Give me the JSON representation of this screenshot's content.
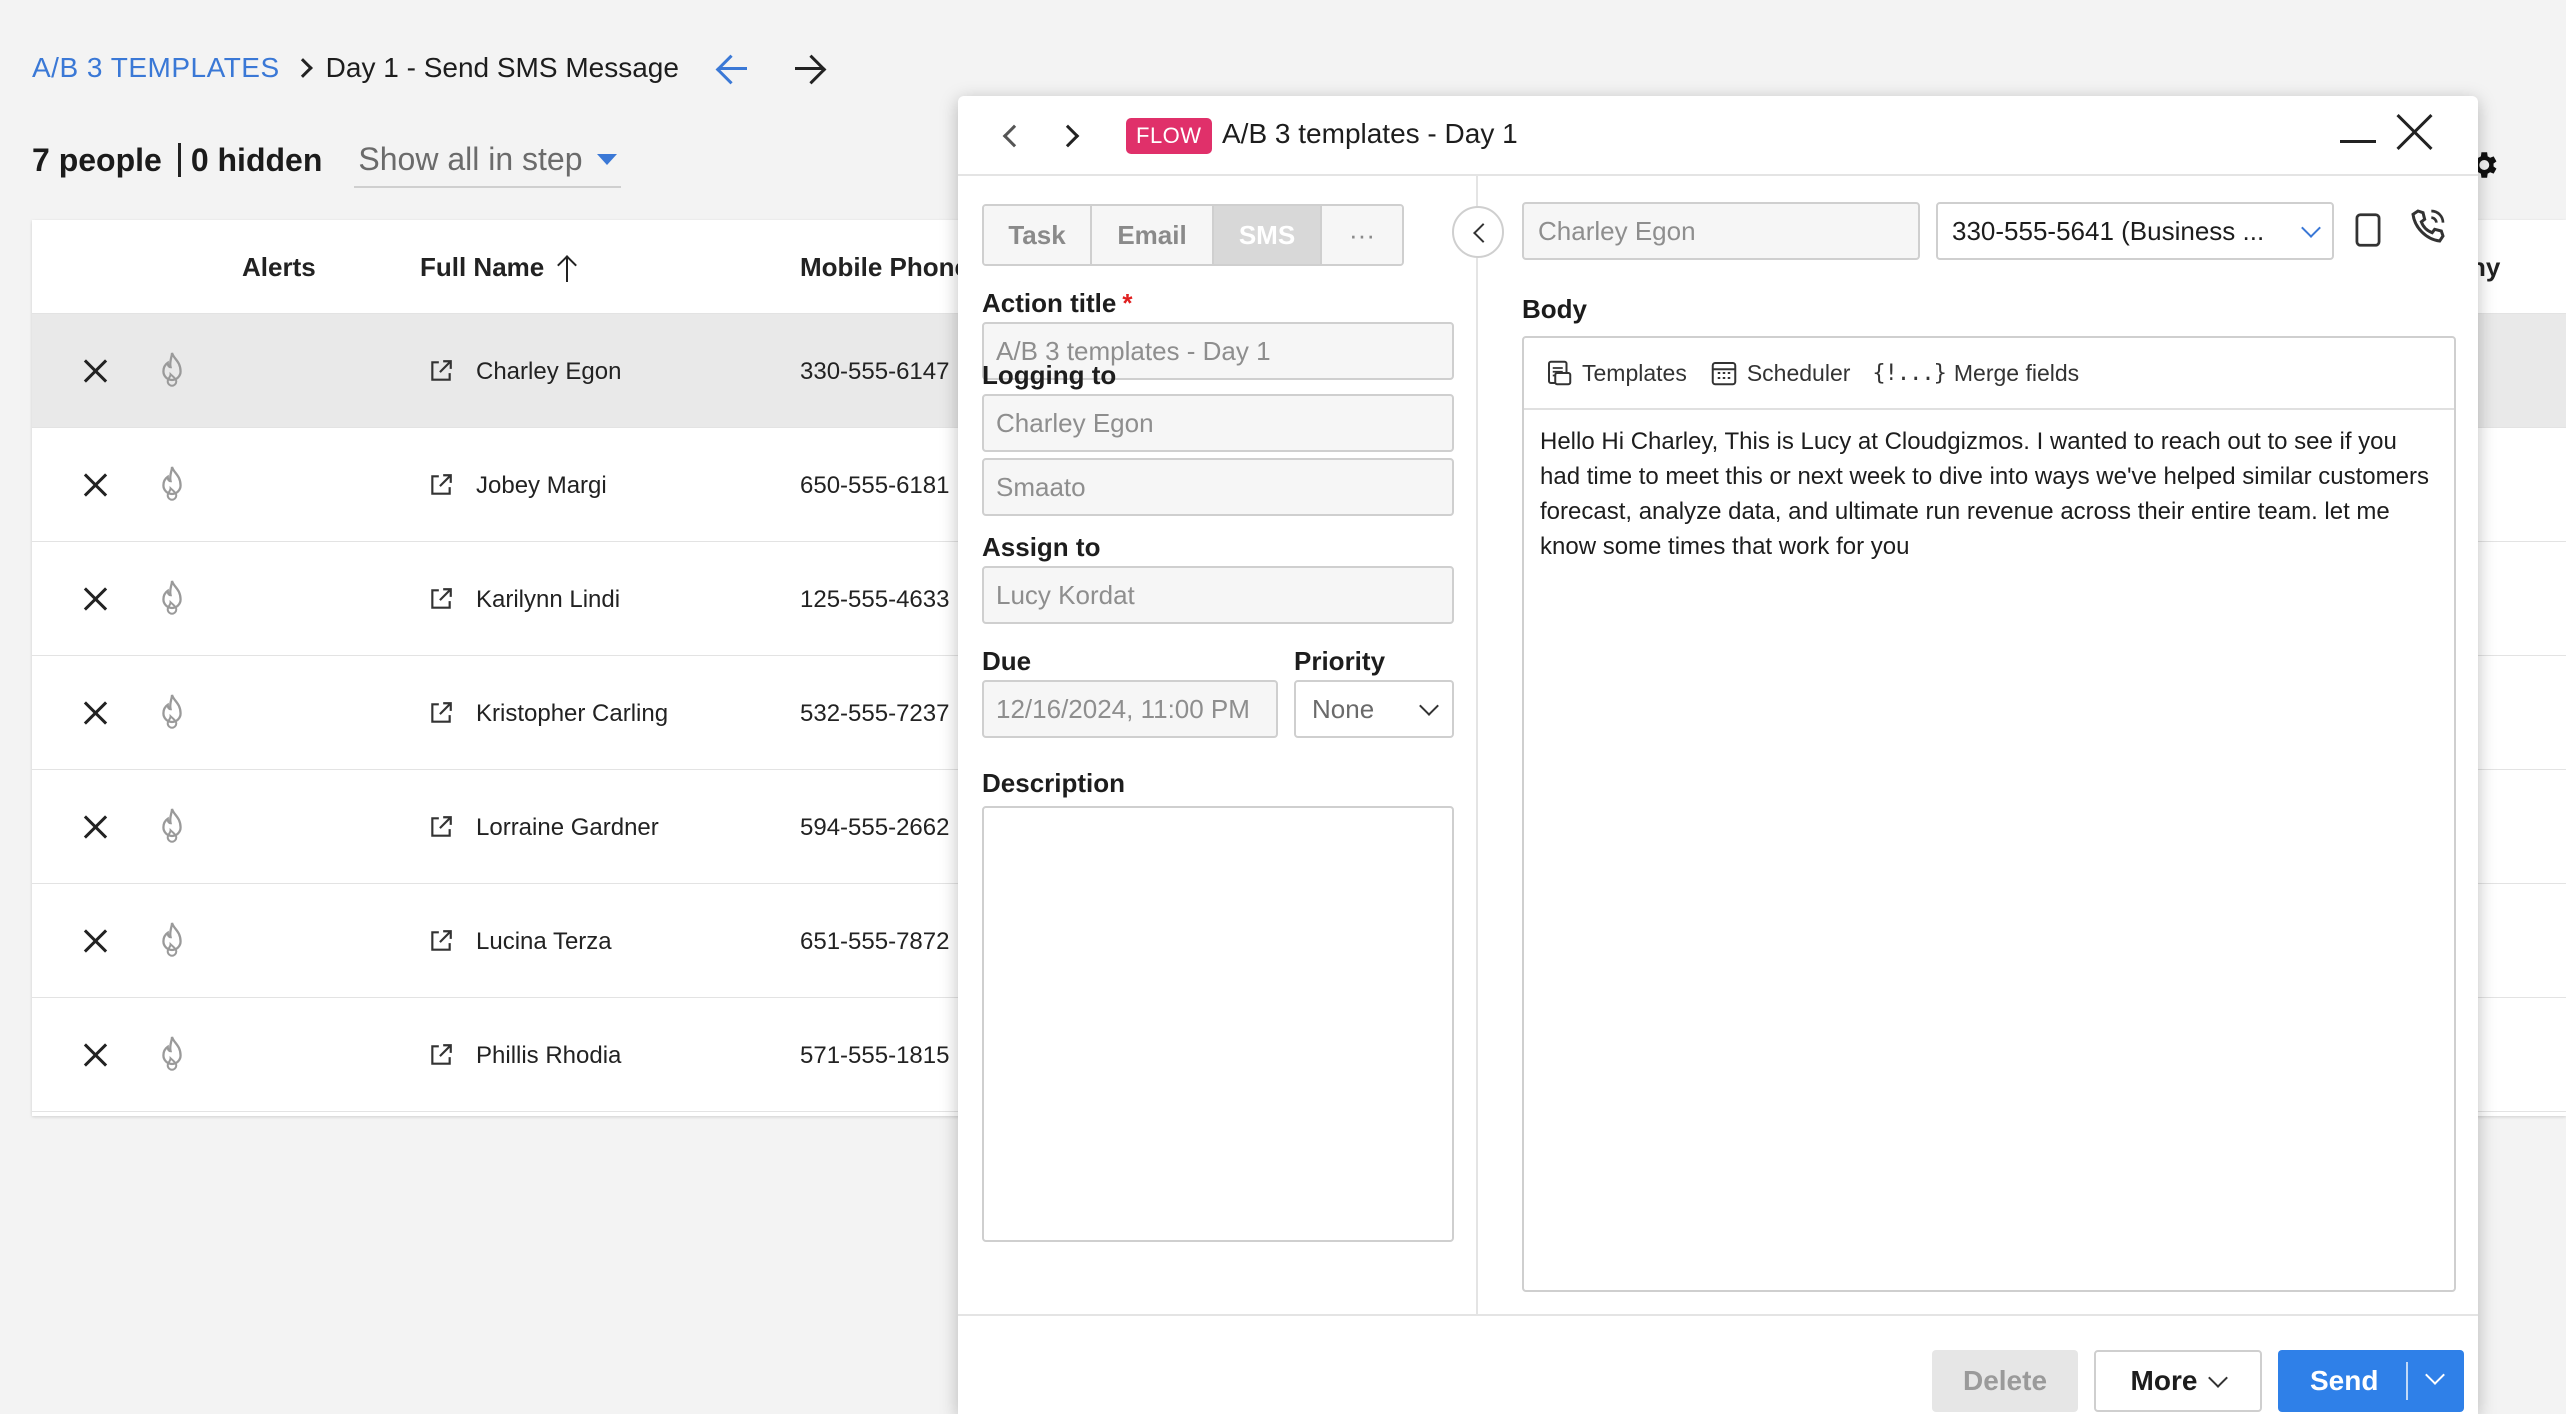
{
  "breadcrumb": {
    "root": "A/B 3 TEMPLATES",
    "current": "Day 1 - Send SMS Message"
  },
  "summary": {
    "people": "7 people",
    "hidden": "0 hidden",
    "filter": "Show all in step"
  },
  "table": {
    "headers": {
      "alerts": "Alerts",
      "full_name": "Full Name",
      "mobile_phone": "Mobile Phone"
    },
    "trailing_header": "ny",
    "rows": [
      {
        "name": "Charley Egon",
        "phone": "330-555-6147",
        "selected": true
      },
      {
        "name": "Jobey Margi",
        "phone": "650-555-6181"
      },
      {
        "name": "Karilynn Lindi",
        "phone": "125-555-4633"
      },
      {
        "name": "Kristopher Carling",
        "phone": "532-555-7237"
      },
      {
        "name": "Lorraine Gardner",
        "phone": "594-555-2662"
      },
      {
        "name": "Lucina Terza",
        "phone": "651-555-7872"
      },
      {
        "name": "Phillis Rhodia",
        "phone": "571-555-1815"
      }
    ]
  },
  "modal": {
    "badge": "FLOW",
    "title": "A/B 3 templates - Day 1",
    "tabs": [
      "Task",
      "Email",
      "SMS",
      "···"
    ],
    "action_title_label": "Action title",
    "required_mark": "*",
    "action_title_value": "A/B 3 templates - Day 1",
    "logging_label": "Logging to",
    "logging_contact": "Charley Egon",
    "logging_account": "Smaato",
    "assign_label": "Assign to",
    "assign_value": "Lucy Kordat",
    "due_label": "Due",
    "due_value": "12/16/2024, 11:00 PM",
    "priority_label": "Priority",
    "priority_value": "None",
    "description_label": "Description",
    "to_contact": "Charley Egon",
    "phone_value": "330-555-5641 (Business ...",
    "body_label": "Body",
    "toolbar": {
      "templates": "Templates",
      "scheduler": "Scheduler",
      "merge_glyph": "{!...}",
      "merge": "Merge fields"
    },
    "body_text": "Hello Hi Charley, This is Lucy at Cloudgizmos. I wanted to reach out to see if you had time to meet this or next week to dive into ways we've helped similar customers forecast, analyze data, and ultimate run revenue across their entire team. let me know some times that work for you",
    "footer": {
      "delete": "Delete",
      "more": "More",
      "send": "Send"
    }
  },
  "colors": {
    "accent": "#2f80e8",
    "link": "#3a78d6",
    "flow_badge": "#e0306a"
  }
}
